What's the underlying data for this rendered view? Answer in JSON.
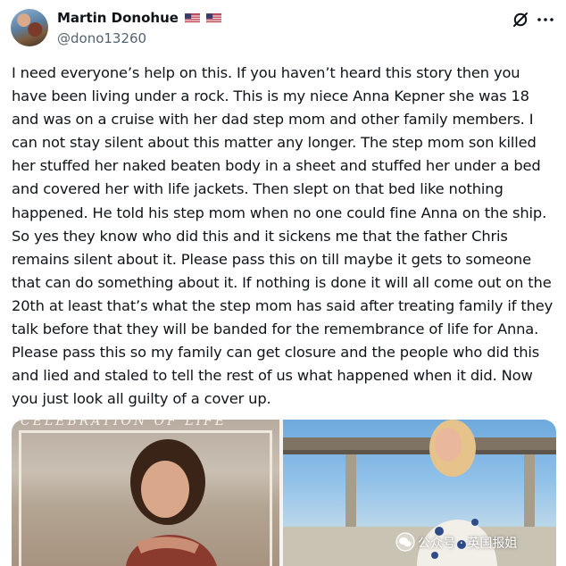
{
  "post": {
    "author": {
      "name": "Martin Donohue",
      "handle": "@dono13260",
      "avatar_icon": "avatar-photo",
      "name_badges": [
        "us-flag-icon",
        "us-flag-icon"
      ]
    },
    "actions": {
      "grok_icon": "grok-icon",
      "more_icon": "more-options-icon"
    },
    "text": "I need everyone’s help on this. If you haven’t heard this story then you have been living under a rock. This is my niece Anna Kepner she was 18 and was on a cruise with her dad step mom and other family members. I can not stay silent about this matter any longer. The step mom son killed her stuffed her naked beaten body in a sheet and stuffed her under a bed and covered her with life jackets. Then slept on that bed like nothing happened. He told his step mom when no one could fine Anna on the ship. So yes they know who did this and it sickens me that the father Chris remains silent about it. Please pass this on till maybe it gets to someone that can do something about it. If nothing is done it will all come out on the 20th at least that’s what the step mom has said after treating family if they talk before that they will be banded for the remembrance of life for Anna. Please pass this so my family can get closure and the people who did this and lied and staled to tell the rest of us what happened when it did. Now you just look all guilty of a cover up.",
    "media": {
      "left_caption": "CELEBRATION OF LIFE",
      "watermark": "公众号 · 英国报姐"
    }
  },
  "colors": {
    "text": "#0f1419",
    "secondary": "#536471",
    "background": "#ffffff"
  }
}
